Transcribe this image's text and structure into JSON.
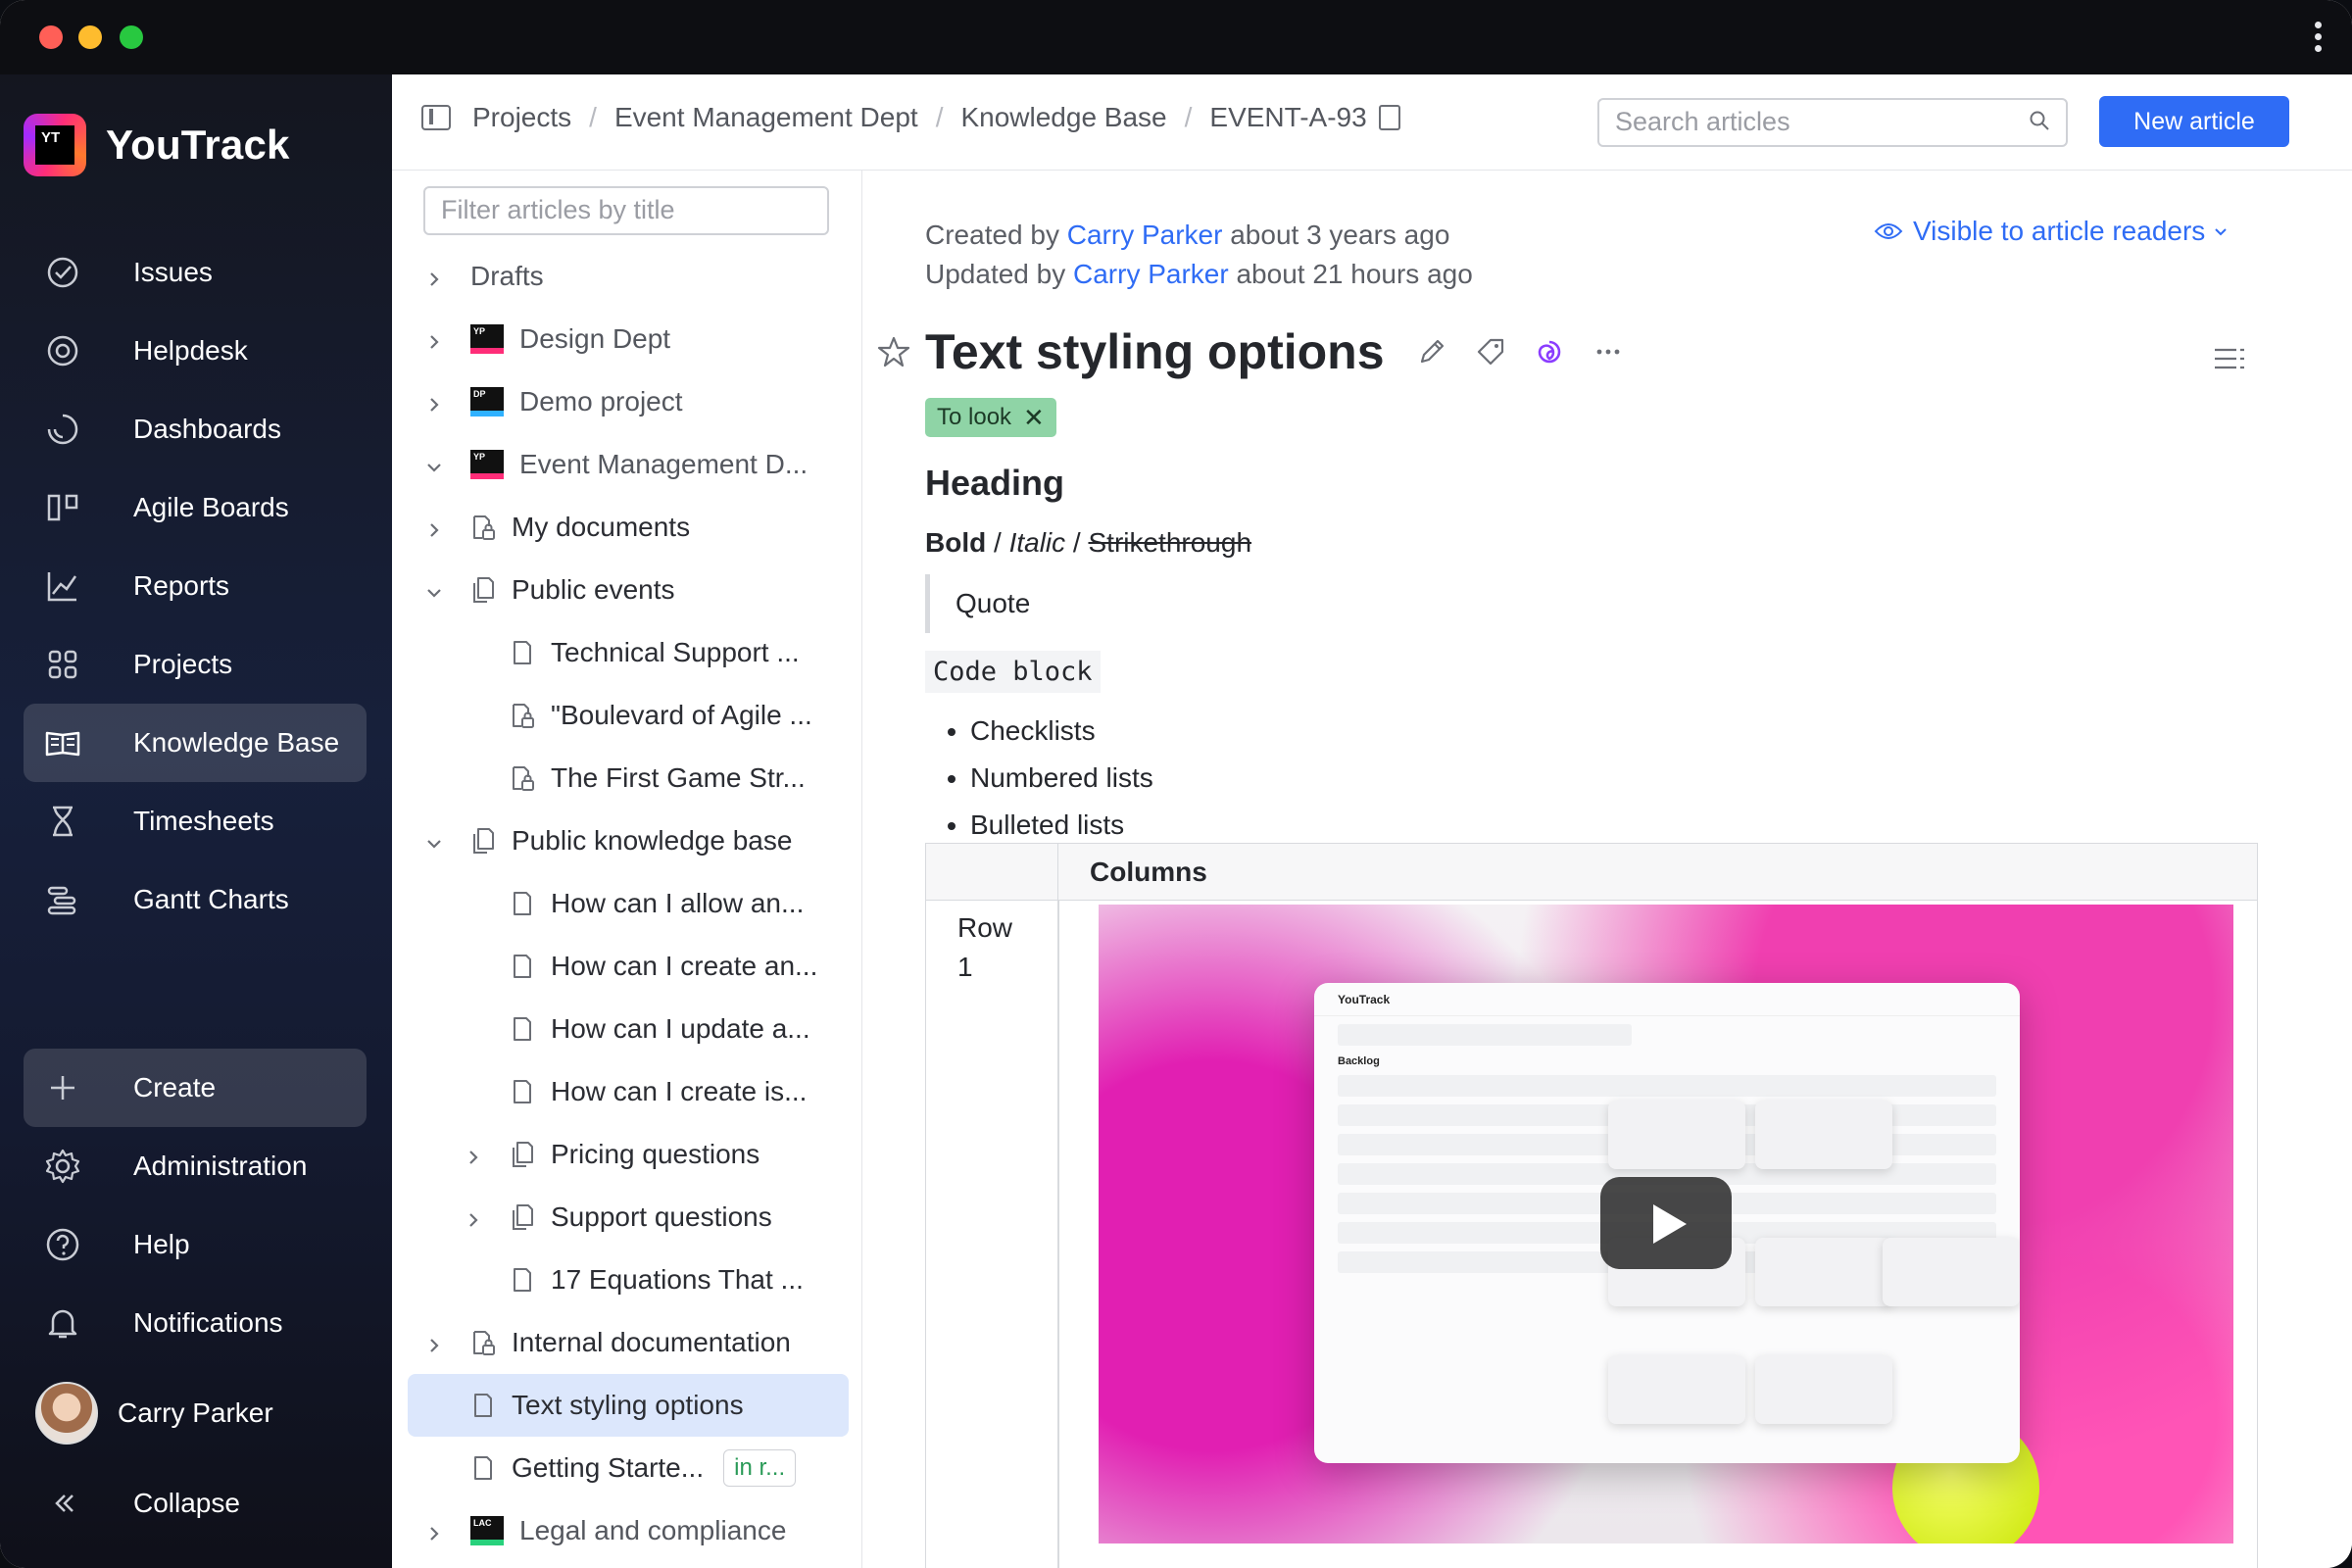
{
  "app": {
    "name": "YouTrack"
  },
  "sidebar": {
    "items": [
      {
        "label": "Issues",
        "icon": "check-circle-icon"
      },
      {
        "label": "Helpdesk",
        "icon": "lifebuoy-icon"
      },
      {
        "label": "Dashboards",
        "icon": "gauge-icon"
      },
      {
        "label": "Agile Boards",
        "icon": "board-icon"
      },
      {
        "label": "Reports",
        "icon": "chart-icon"
      },
      {
        "label": "Projects",
        "icon": "grid-icon"
      },
      {
        "label": "Knowledge Base",
        "icon": "book-icon",
        "active": true
      },
      {
        "label": "Timesheets",
        "icon": "hourglass-icon"
      },
      {
        "label": "Gantt Charts",
        "icon": "gantt-icon"
      }
    ],
    "bottom": [
      {
        "label": "Create",
        "icon": "plus-icon"
      },
      {
        "label": "Administration",
        "icon": "gear-icon"
      },
      {
        "label": "Help",
        "icon": "help-icon"
      },
      {
        "label": "Notifications",
        "icon": "bell-icon"
      }
    ],
    "user": {
      "name": "Carry Parker"
    },
    "collapse_label": "Collapse"
  },
  "breadcrumb": [
    "Projects",
    "Event Management Dept",
    "Knowledge Base",
    "EVENT-A-93"
  ],
  "search": {
    "placeholder": "Search articles"
  },
  "new_article_label": "New article",
  "tree": {
    "filter_placeholder": "Filter articles by title",
    "nodes": [
      {
        "label": "Drafts",
        "expand": "collapsed",
        "indent": 0,
        "icon": "none"
      },
      {
        "label": "Design Dept",
        "expand": "collapsed",
        "indent": 0,
        "icon": "project",
        "badge": "YP",
        "badge_color": "pink"
      },
      {
        "label": "Demo project",
        "expand": "collapsed",
        "indent": 0,
        "icon": "project",
        "badge": "DP",
        "badge_color": "blue"
      },
      {
        "label": "Event Management D...",
        "expand": "expanded",
        "indent": 0,
        "icon": "project",
        "badge": "YP",
        "badge_color": "pink"
      },
      {
        "label": "My documents",
        "expand": "collapsed",
        "indent": 0,
        "icon": "locked-doc"
      },
      {
        "label": "Public events",
        "expand": "expanded",
        "indent": 0,
        "icon": "docs"
      },
      {
        "label": "Technical Support ...",
        "expand": "none",
        "indent": 1,
        "icon": "doc"
      },
      {
        "label": "\"Boulevard of Agile ...",
        "expand": "none",
        "indent": 1,
        "icon": "locked-doc"
      },
      {
        "label": "The First Game Str...",
        "expand": "none",
        "indent": 1,
        "icon": "locked-doc"
      },
      {
        "label": "Public knowledge base",
        "expand": "expanded",
        "indent": 0,
        "icon": "docs"
      },
      {
        "label": "How can I allow an...",
        "expand": "none",
        "indent": 1,
        "icon": "doc"
      },
      {
        "label": "How can I create an...",
        "expand": "none",
        "indent": 1,
        "icon": "doc"
      },
      {
        "label": "How can I update a...",
        "expand": "none",
        "indent": 1,
        "icon": "doc"
      },
      {
        "label": "How can I create is...",
        "expand": "none",
        "indent": 1,
        "icon": "doc"
      },
      {
        "label": "Pricing questions",
        "expand": "collapsed",
        "indent": 1,
        "icon": "docs"
      },
      {
        "label": "Support questions",
        "expand": "collapsed",
        "indent": 1,
        "icon": "docs"
      },
      {
        "label": "17 Equations That ...",
        "expand": "none",
        "indent": 1,
        "icon": "doc"
      },
      {
        "label": "Internal documentation",
        "expand": "collapsed",
        "indent": 0,
        "icon": "locked-doc"
      },
      {
        "label": "Text styling options",
        "expand": "none",
        "indent": 0,
        "icon": "doc",
        "active": true
      },
      {
        "label": "Getting Starte...",
        "expand": "none",
        "indent": 0,
        "icon": "doc",
        "tag": "in r..."
      },
      {
        "label": "Legal and compliance",
        "expand": "collapsed",
        "indent": 0,
        "icon": "project",
        "badge": "LAC",
        "badge_color": "green"
      }
    ]
  },
  "article": {
    "created_prefix": "Created by",
    "created_author": "Carry Parker",
    "created_when": "about 3 years ago",
    "updated_prefix": "Updated by",
    "updated_author": "Carry Parker",
    "updated_when": "about 21 hours ago",
    "visibility_label": "Visible to article readers",
    "title": "Text styling options",
    "tag": "To look",
    "heading": "Heading",
    "bold": "Bold",
    "italic": "Italic",
    "strike": "Strikethrough",
    "slash": "/",
    "quote": "Quote",
    "code": "Code block",
    "bullets": [
      "Checklists",
      "Numbered lists",
      "Bulleted lists"
    ],
    "table": {
      "header": "Columns",
      "row_label": "Row 1"
    },
    "video_mock": {
      "app_name": "YouTrack",
      "section": "Backlog"
    }
  }
}
